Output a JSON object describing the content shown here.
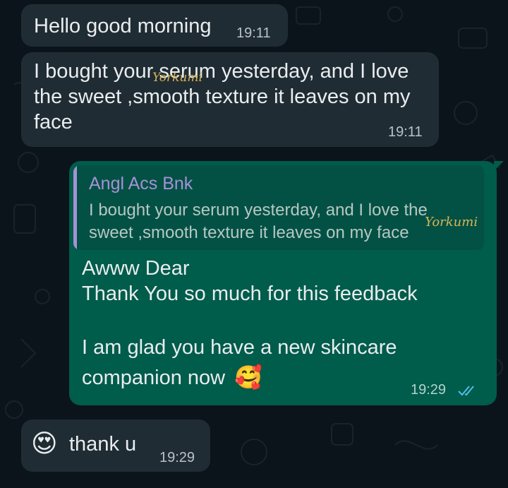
{
  "messages": {
    "m1": {
      "text": "Hello good morning",
      "time": "19:11"
    },
    "m2": {
      "text": "I bought your serum yesterday, and I love\nthe sweet ,smooth texture it leaves on my\nface",
      "time": "19:11"
    },
    "m3": {
      "quote_author": "Angl Acs Bnk",
      "quote_text": "I bought your serum yesterday, and I love the\nsweet ,smooth texture it leaves on my face",
      "text_line1": "Awww Dear",
      "text_line2": "Thank You so much for this feedback",
      "text_line4": "I am glad you have a new skincare",
      "text_line5": "companion now",
      "emoji": "🥰",
      "time": "19:29",
      "status_icon": "double-check-read-icon"
    },
    "m4": {
      "emoji": "😍",
      "text": "thank u",
      "time": "19:29"
    }
  },
  "watermark": "Yorkumi",
  "colors": {
    "background": "#0b141a",
    "incoming_bubble": "#202c33",
    "outgoing_bubble": "#005c4b",
    "quote_accent": "#a791d6",
    "read_tick": "#53bdeb"
  }
}
